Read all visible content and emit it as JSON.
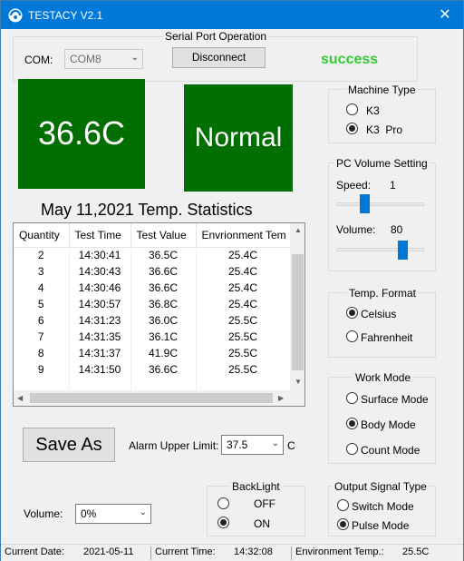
{
  "window": {
    "title": "TESTACY   V2.1",
    "close_glyph": "✕",
    "accent": "#0078d7"
  },
  "serial": {
    "group_title": "Serial Port Operation",
    "com_label": "COM:",
    "com_value": "COM8",
    "disconnect_label": "Disconnect",
    "status_text": "success",
    "status_color": "#33cc33"
  },
  "display": {
    "temperature": "36.6C",
    "status": "Normal",
    "box_color": "#006e00"
  },
  "statistics": {
    "title": "May 11,2021 Temp. Statistics",
    "columns": [
      "Quantity",
      "Test Time",
      "Test Value",
      "Envrionment Tem"
    ],
    "rows": [
      [
        "2",
        "14:30:41",
        "36.5C",
        "25.4C"
      ],
      [
        "3",
        "14:30:43",
        "36.6C",
        "25.4C"
      ],
      [
        "4",
        "14:30:46",
        "36.6C",
        "25.4C"
      ],
      [
        "5",
        "14:30:57",
        "36.8C",
        "25.4C"
      ],
      [
        "6",
        "14:31:23",
        "36.0C",
        "25.5C"
      ],
      [
        "7",
        "14:31:35",
        "36.1C",
        "25.5C"
      ],
      [
        "8",
        "14:31:37",
        "41.9C",
        "25.5C"
      ],
      [
        "9",
        "14:31:50",
        "36.6C",
        "25.5C"
      ]
    ]
  },
  "actions": {
    "save_as_label": "Save As",
    "alarm_label": "Alarm Upper Limit:",
    "alarm_value": "37.5",
    "alarm_unit": "C",
    "volume_label": "Volume:",
    "volume_value": "0%"
  },
  "backlight": {
    "title": "BackLight",
    "off_label": "OFF",
    "on_label": "ON",
    "selected": "ON"
  },
  "machine_type": {
    "title": "Machine Type",
    "options": [
      "K3",
      "K3  Pro"
    ],
    "selected": "K3  Pro"
  },
  "pc_volume": {
    "title": "PC Volume Setting",
    "speed_label": "Speed:",
    "speed_value": "1",
    "volume_label": "Volume:",
    "volume_value": "80"
  },
  "temp_format": {
    "title": "Temp. Format",
    "options": [
      "Celsius",
      "Fahrenheit"
    ],
    "selected": "Celsius"
  },
  "work_mode": {
    "title": "Work Mode",
    "options": [
      "Surface Mode",
      "Body Mode",
      "Count Mode"
    ],
    "selected": "Body Mode"
  },
  "output_signal": {
    "title": "Output Signal Type",
    "options": [
      "Switch Mode",
      "Pulse Mode"
    ],
    "selected": "Pulse Mode"
  },
  "statusbar": {
    "date_label": "Current Date:",
    "date_value": "2021-05-11",
    "time_label": "Current Time:",
    "time_value": "14:32:08",
    "env_label": "Environment Temp.:",
    "env_value": "25.5C"
  }
}
